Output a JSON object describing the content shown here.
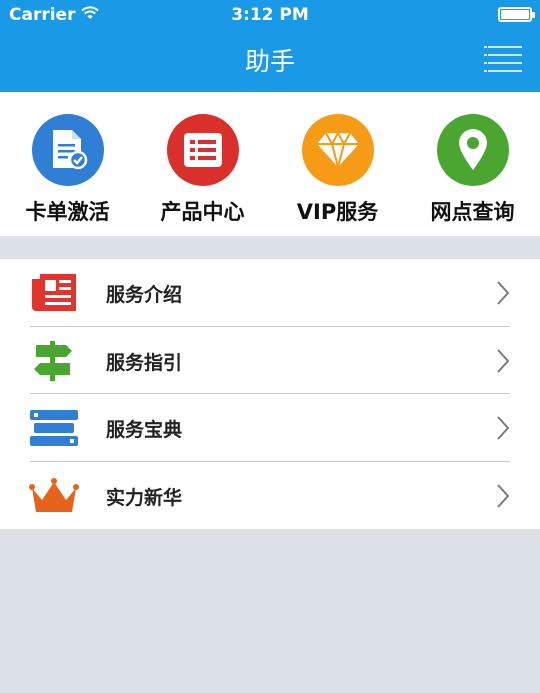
{
  "status_bar": {
    "carrier": "Carrier",
    "time": "3:12 PM"
  },
  "header": {
    "title": "助手",
    "menu_icon": "hamburger-menu-icon"
  },
  "quick_actions": [
    {
      "label": "卡单激活",
      "icon": "document-check-icon",
      "color": "#2f7fd7"
    },
    {
      "label": "产品中心",
      "icon": "list-icon",
      "color": "#d9302b"
    },
    {
      "label": "VIP服务",
      "icon": "diamond-icon",
      "color": "#f59b16"
    },
    {
      "label": "网点查询",
      "icon": "location-pin-icon",
      "color": "#4aa631"
    }
  ],
  "menu_list": [
    {
      "label": "服务介绍",
      "icon": "newspaper-icon",
      "color": "#e0342c"
    },
    {
      "label": "服务指引",
      "icon": "signpost-icon",
      "color": "#4aa631"
    },
    {
      "label": "服务宝典",
      "icon": "book-stack-icon",
      "color": "#2f7fd7"
    },
    {
      "label": "实力新华",
      "icon": "crown-icon",
      "color": "#e8631a"
    }
  ],
  "colors": {
    "header": "#1a9ae6",
    "background": "#dde1e8"
  }
}
